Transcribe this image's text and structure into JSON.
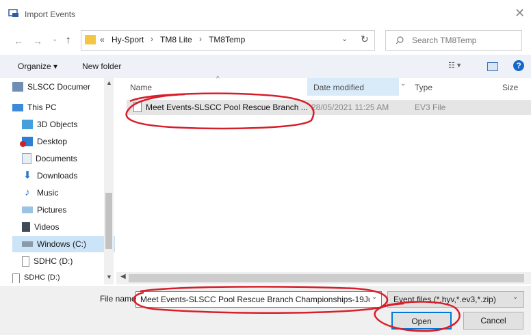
{
  "window": {
    "title": "Import Events",
    "close_glyph": "✕"
  },
  "nav": {
    "breadcrumb_chevrons": "«",
    "path": [
      "Hy-Sport",
      "TM8 Lite",
      "TM8Temp"
    ],
    "separator": "›",
    "search_placeholder": "Search TM8Temp"
  },
  "toolbar": {
    "organize_label": "Organize ▾",
    "new_folder_label": "New folder"
  },
  "sidebar": {
    "items": [
      {
        "label": "SLSCC Documer",
        "icon": "network-folder-icon"
      },
      {
        "label": "This PC",
        "icon": "computer-icon"
      },
      {
        "label": "3D Objects",
        "icon": "3d-objects-icon"
      },
      {
        "label": "Desktop",
        "icon": "desktop-icon"
      },
      {
        "label": "Documents",
        "icon": "documents-icon"
      },
      {
        "label": "Downloads",
        "icon": "downloads-icon"
      },
      {
        "label": "Music",
        "icon": "music-icon"
      },
      {
        "label": "Pictures",
        "icon": "pictures-icon"
      },
      {
        "label": "Videos",
        "icon": "videos-icon"
      },
      {
        "label": "Windows (C:)",
        "icon": "drive-icon",
        "selected": true
      },
      {
        "label": "SDHC (D:)",
        "icon": "sd-card-icon"
      },
      {
        "label": "SDHC (D:)",
        "icon": "sd-card-icon"
      }
    ]
  },
  "columns": {
    "name": "Name",
    "date": "Date modified",
    "type": "Type",
    "size": "Size"
  },
  "files": [
    {
      "name": "Meet Events-SLSCC Pool Rescue Branch ...",
      "date": "28/05/2021 11:25 AM",
      "type": "EV3 File"
    }
  ],
  "footer": {
    "filename_label": "File name:",
    "filename_value": "Meet Events-SLSCC Pool Rescue Branch Championships-19Ju",
    "filter_value": "Event files (*.hyv,*.ev3,*.zip)",
    "open_label": "Open",
    "cancel_label": "Cancel"
  },
  "colors": {
    "annotation": "#d81e2a",
    "selection": "#cce4f7",
    "row_highlight": "#e5e5e5"
  }
}
